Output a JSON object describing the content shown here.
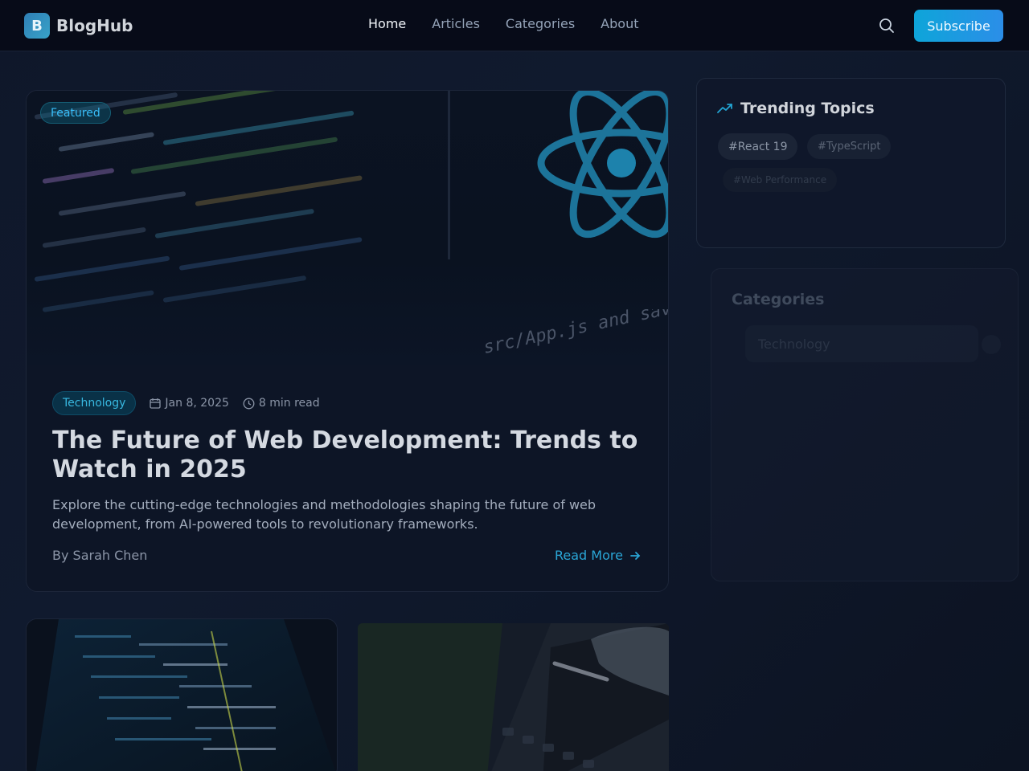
{
  "brand": {
    "logo_letter": "B",
    "name": "BlogHub"
  },
  "nav": {
    "items": [
      "Home",
      "Articles",
      "Categories",
      "About"
    ],
    "active": "Home"
  },
  "header": {
    "search_icon": "search-icon",
    "subscribe_label": "Subscribe"
  },
  "featured": {
    "badge": "Featured",
    "category": "Technology",
    "date": "Jan 8, 2025",
    "read_time": "8 min read",
    "title": "The Future of Web Development: Trends to Watch in 2025",
    "excerpt": "Explore the cutting-edge technologies and methodologies shaping the future of web development, from AI-powered tools to revolutionary frameworks.",
    "author": "By Sarah Chen",
    "read_more": "Read More",
    "image_caption_text": "src/App.js and save"
  },
  "sidebar": {
    "trending": {
      "title": "Trending Topics",
      "tags": [
        "#React 19",
        "#TypeScript",
        "#Web Performance"
      ]
    },
    "categories": {
      "title": "Categories",
      "items": [
        "Technology"
      ]
    }
  },
  "colors": {
    "accent": "#0ea5d9",
    "background": "#0f172a",
    "card": "#0d1526",
    "link": "#2aa6d6"
  }
}
